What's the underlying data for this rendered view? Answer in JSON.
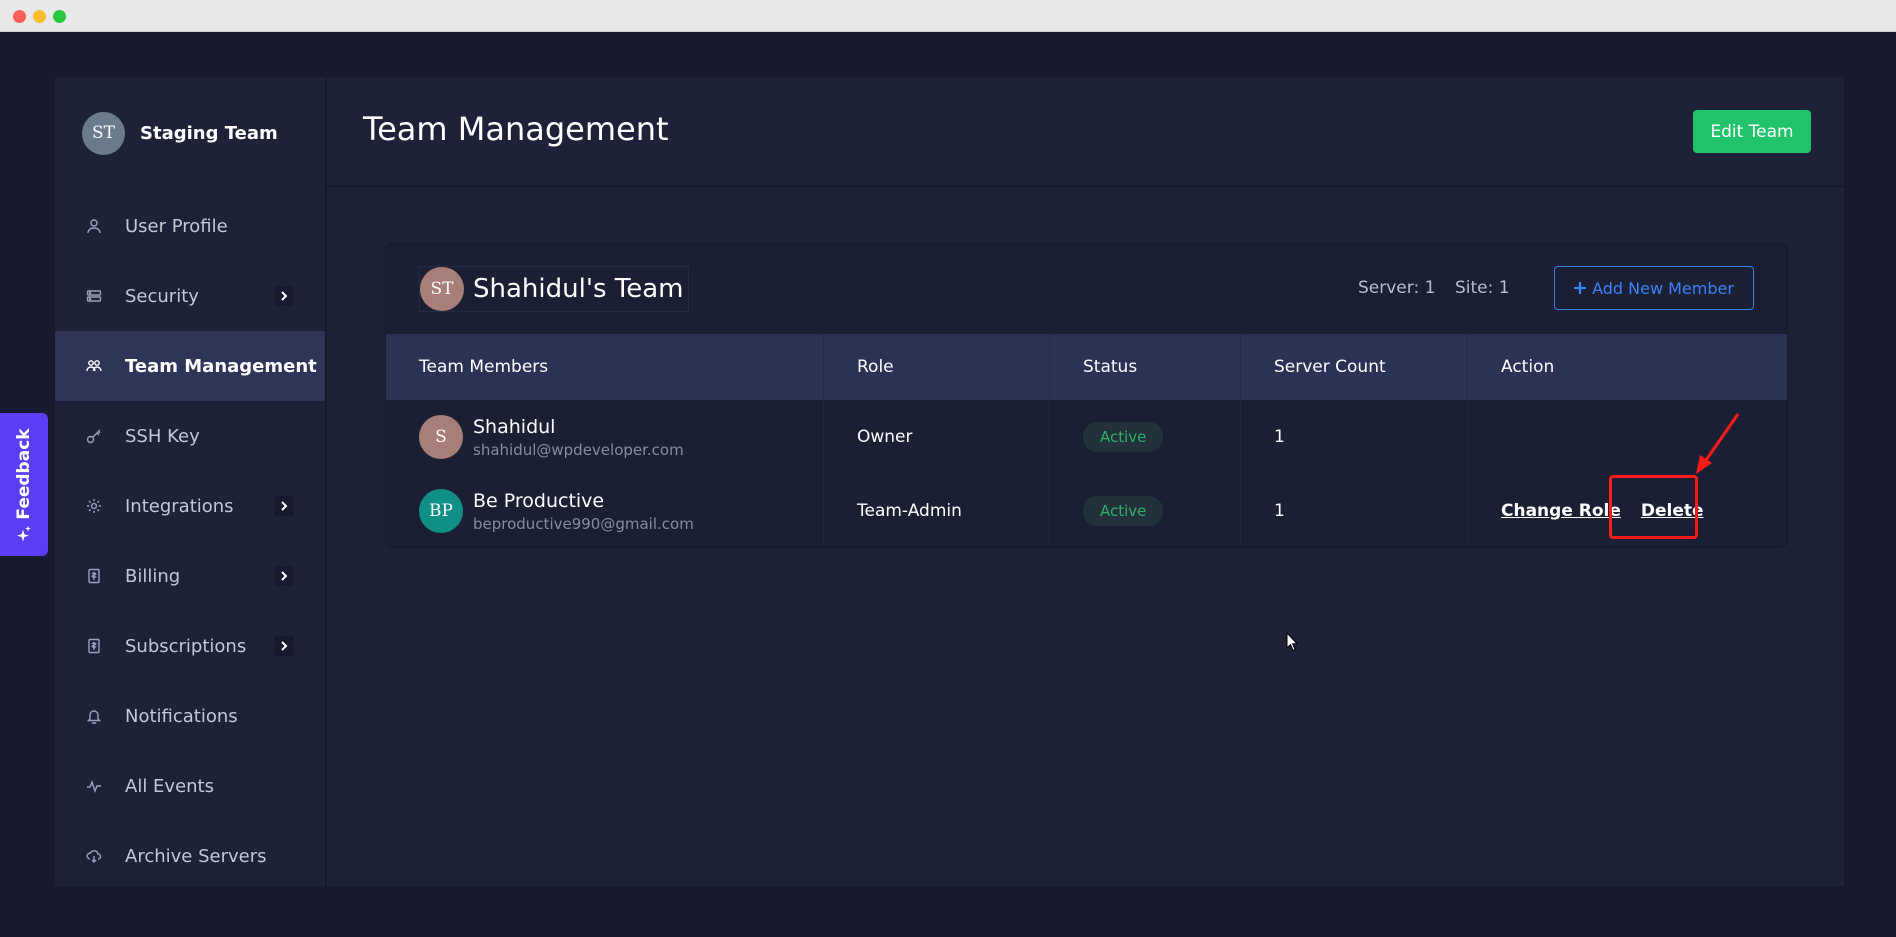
{
  "sidebar": {
    "team": {
      "initials": "ST",
      "name": "Staging Team"
    },
    "items": [
      {
        "label": "User Profile",
        "icon": "user-icon",
        "chevron": false,
        "active": false
      },
      {
        "label": "Security",
        "icon": "security-icon",
        "chevron": true,
        "active": false
      },
      {
        "label": "Team Management",
        "icon": "team-icon",
        "chevron": false,
        "active": true
      },
      {
        "label": "SSH Key",
        "icon": "key-icon",
        "chevron": false,
        "active": false
      },
      {
        "label": "Integrations",
        "icon": "gear-icon",
        "chevron": true,
        "active": false
      },
      {
        "label": "Billing",
        "icon": "billing-icon",
        "chevron": true,
        "active": false
      },
      {
        "label": "Subscriptions",
        "icon": "subscriptions-icon",
        "chevron": true,
        "active": false
      },
      {
        "label": "Notifications",
        "icon": "bell-icon",
        "chevron": false,
        "active": false
      },
      {
        "label": "All Events",
        "icon": "activity-icon",
        "chevron": false,
        "active": false
      },
      {
        "label": "Archive Servers",
        "icon": "archive-icon",
        "chevron": false,
        "active": false
      }
    ]
  },
  "header": {
    "title": "Team Management",
    "edit_button": "Edit Team"
  },
  "card": {
    "team_initials": "ST",
    "team_name": "Shahidul's Team",
    "server_count": "Server: 1",
    "site_count": "Site: 1",
    "add_button": "Add New Member"
  },
  "table": {
    "columns": [
      "Team Members",
      "Role",
      "Status",
      "Server Count",
      "Action"
    ],
    "rows": [
      {
        "initials": "S",
        "name": "Shahidul",
        "email": "shahidul@wpdeveloper.com",
        "role": "Owner",
        "status": "Active",
        "server_count": "1",
        "actions": []
      },
      {
        "initials": "BP",
        "name": "Be Productive",
        "email": "beproductive990@gmail.com",
        "role": "Team-Admin",
        "status": "Active",
        "server_count": "1",
        "actions": [
          "Change Role",
          "Delete"
        ]
      }
    ]
  },
  "feedback": {
    "label": "Feedback"
  },
  "colors": {
    "background": "#171a2e",
    "panel": "#1e2238",
    "active_nav": "#2e3559",
    "table_header": "#2c3256",
    "primary_green": "#22c36d",
    "accent_blue": "#3b82f6",
    "status_green": "#2fb06a",
    "feedback_purple": "#5b3df5",
    "annotation_red": "#ff1a1a"
  }
}
